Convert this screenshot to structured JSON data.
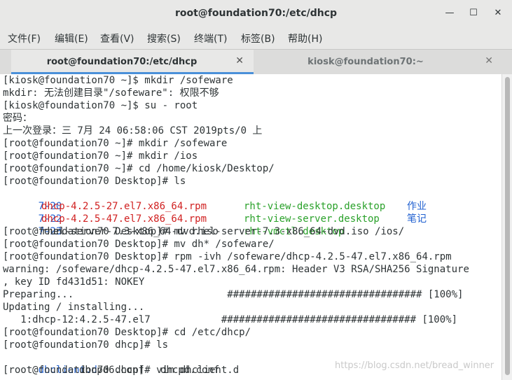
{
  "window": {
    "title": "root@foundation70:/etc/dhcp",
    "min_glyph": "—",
    "max_glyph": "☐",
    "close_glyph": "✕"
  },
  "menu": [
    "文件(F)",
    "编辑(E)",
    "查看(V)",
    "搜索(S)",
    "终端(T)",
    "标签(B)",
    "帮助(H)"
  ],
  "tabs": [
    {
      "label": "root@foundation70:/etc/dhcp",
      "close": "✕"
    },
    {
      "label": "kiosk@foundation70:~",
      "close": "✕"
    }
  ],
  "terminal": {
    "lines": [
      "[kiosk@foundation70 ~]$ mkdir /sofeware",
      "mkdir: 无法创建目录\"/sofeware\": 权限不够",
      "[kiosk@foundation70 ~]$ su - root",
      "密码：",
      "上一次登录：三 7月 24 06:58:06 CST 2019pts/0 上",
      "[root@foundation70 ~]# mkdir /sofeware",
      "[root@foundation70 ~]# mkdir /ios",
      "[root@foundation70 ~]# cd /home/kiosk/Desktop/",
      "[root@foundation70 Desktop]# ls",
      {
        "c1": "7-20",
        "c2": "dhcp-4.2.5-27.el7.x86_64.rpm",
        "c3": "rht-view-desktop.desktop",
        "c4": "作业"
      },
      {
        "c1": "7-22",
        "c2": "dhcp-4.2.5-47.el7.x86_64.rpm",
        "c3": "rht-view-server.desktop",
        "c4": "笔记"
      },
      {
        "c1": "7-23",
        "c2": "rhel-server-7.3-x86_64-dvd.iso",
        "c3": "rht-vmctl.desktop",
        "c4": ""
      },
      "[root@foundation70 Desktop]# mv rhel-server-7.3-x86_64-dvd.iso /ios/",
      "[root@foundation70 Desktop]# mv dh* /sofeware/",
      "[root@foundation70 Desktop]# rpm -ivh /sofeware/dhcp-4.2.5-47.el7.x86_64.rpm",
      "warning: /sofeware/dhcp-4.2.5-47.el7.x86_64.rpm: Header V3 RSA/SHA256 Signature",
      ", key ID fd431d51: NOKEY",
      "Preparing...                          ################################# [100%]",
      "Updating / installing...",
      "   1:dhcp-12:4.2.5-47.el7            ################################# [100%]",
      "[root@foundation70 Desktop]# cd /etc/dhcp/",
      "[root@foundation70 dhcp]# ls",
      {
        "c1": "dhclient.d",
        "c2": "dhcpd6.conf",
        "c3": "dhcpd.conf",
        "c4": ""
      },
      "[root@foundation70 dhcp]# vim dhclient.d"
    ]
  },
  "watermark": "https://blog.csdn.net/bread_winner"
}
